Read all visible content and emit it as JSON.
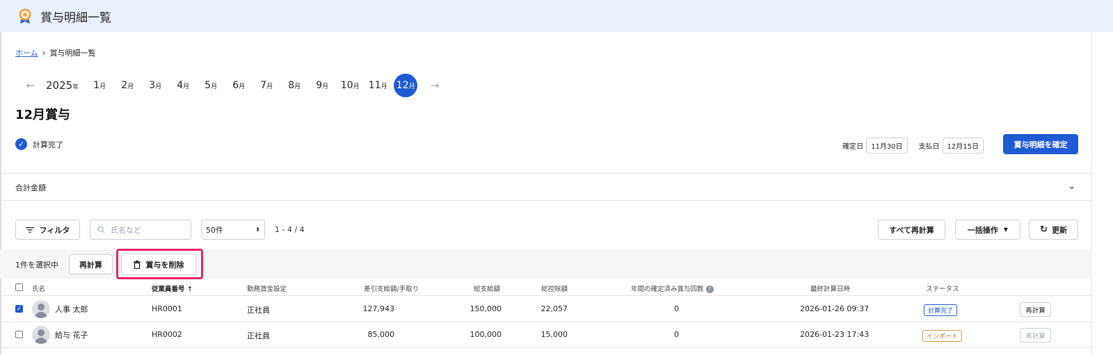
{
  "app": {
    "title": "賞与明細一覧"
  },
  "breadcrumb": {
    "home": "ホーム",
    "current": "賞与明細一覧"
  },
  "month_nav": {
    "year": "2025",
    "year_suffix": "年",
    "month_suffix": "月",
    "months": [
      "1",
      "2",
      "3",
      "4",
      "5",
      "6",
      "7",
      "8",
      "9",
      "10",
      "11",
      "12"
    ],
    "active_month": "12"
  },
  "page_title": "12月賞与",
  "status": {
    "label": "計算完了"
  },
  "dates": {
    "confirm_label": "確定日",
    "confirm_value": "11月30日",
    "pay_label": "支払日",
    "pay_value": "12月15日"
  },
  "confirm_button": "賞与明細を確定",
  "summary": {
    "label": "合計金額"
  },
  "toolbar": {
    "filter": "フィルタ",
    "search_placeholder": "氏名など",
    "page_size": "50件",
    "count": "1 - 4 / 4",
    "recalc_all": "すべて再計算",
    "bulk": "一括操作",
    "refresh": "更新"
  },
  "selection": {
    "label": "1件を選択中",
    "recalc": "再計算",
    "delete": "賞与を削除"
  },
  "table": {
    "headers": {
      "name": "氏名",
      "employee_no": "従業員番号",
      "wage_setting": "勤務賃金設定",
      "net": "差引支給額/手取り",
      "gross": "総支給額",
      "deduction": "総控除額",
      "confirmed_count": "年間の確定済み賞与回数",
      "last_calc": "最終計算日時",
      "status": "ステータス"
    },
    "rows": [
      {
        "checked": true,
        "name": "人事 太郎",
        "employee_no": "HR0001",
        "wage_setting": "正社員",
        "net": "127,943",
        "gross": "150,000",
        "deduction": "22,057",
        "confirmed_count": "0",
        "last_calc": "2026-01-26 09:37",
        "status": "計算完了",
        "action": "再計算"
      },
      {
        "checked": false,
        "name": "給与 花子",
        "employee_no": "HR0002",
        "wage_setting": "正社員",
        "net": "85,000",
        "gross": "100,000",
        "deduction": "15,000",
        "confirmed_count": "0",
        "last_calc": "2026-01-23 17:43",
        "status": "インポート",
        "action": "再計算"
      }
    ]
  }
}
